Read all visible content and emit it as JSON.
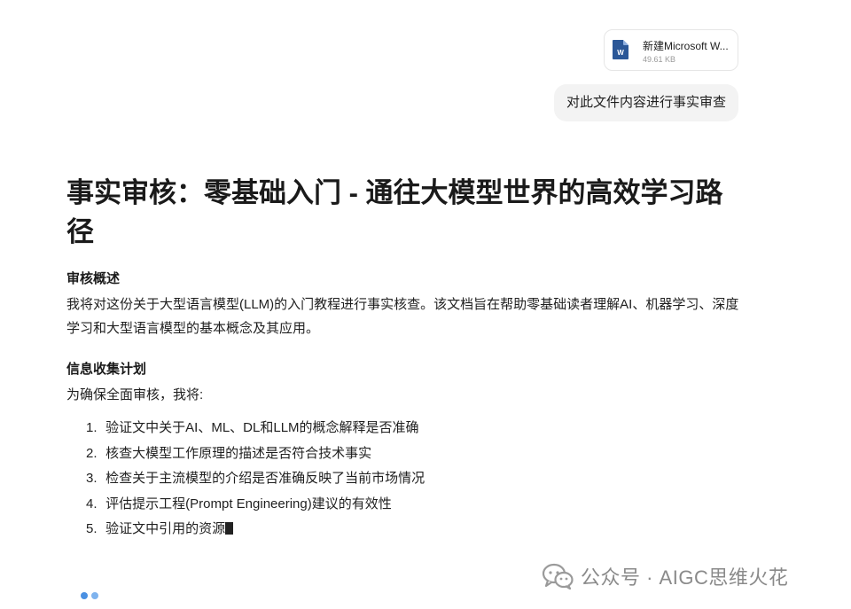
{
  "attachment": {
    "file_name": "新建Microsoft W...",
    "file_size": "49.61 KB",
    "icon": "word-document-icon",
    "icon_letter": "W",
    "icon_color": "#2b5797"
  },
  "user_message": "对此文件内容进行事实审查",
  "answer": {
    "title": "事实审核：零基础入门 - 通往大模型世界的高效学习路径",
    "overview_heading": "审核概述",
    "overview_text": "我将对这份关于大型语言模型(LLM)的入门教程进行事实核查。该文档旨在帮助零基础读者理解AI、机器学习、深度学习和大型语言模型的基本概念及其应用。",
    "plan_heading": "信息收集计划",
    "plan_intro": "为确保全面审核，我将:",
    "plan_items": [
      {
        "num": "1.",
        "text": "验证文中关于AI、ML、DL和LLM的概念解释是否准确"
      },
      {
        "num": "2.",
        "text": "核查大模型工作原理的描述是否符合技术事实"
      },
      {
        "num": "3.",
        "text": "检查关于主流模型的介绍是否准确反映了当前市场情况"
      },
      {
        "num": "4.",
        "text": "评估提示工程(Prompt Engineering)建议的有效性"
      },
      {
        "num": "5.",
        "text": "验证文中引用的资源"
      }
    ]
  },
  "loading_indicator": {
    "dot_color_1": "#4a90e2",
    "dot_color_2": "#7fb3ee"
  },
  "watermark": {
    "text": "公众号 · AIGC思维火花",
    "icon": "wechat-icon"
  }
}
